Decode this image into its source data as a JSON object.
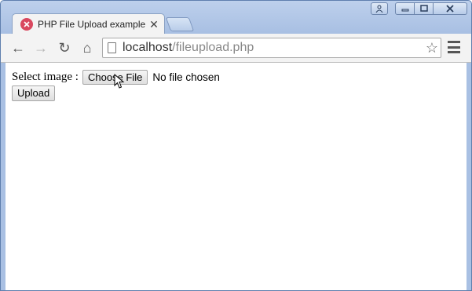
{
  "window": {
    "controls": {
      "user_icon": "person-icon",
      "minimize_icon": "minimize-icon",
      "maximize_icon": "maximize-icon",
      "close_icon": "close-icon"
    }
  },
  "tab": {
    "title": "PHP File Upload example",
    "close_glyph": "✕",
    "favicon": "xampp-icon"
  },
  "toolbar": {
    "back_glyph": "←",
    "forward_glyph": "→",
    "reload_glyph": "↻",
    "home_glyph": "⌂",
    "url_host": "localhost",
    "url_path": "/fileupload.php",
    "star_glyph": "☆"
  },
  "form": {
    "label": "Select image :",
    "choose_button": "Choose File",
    "file_status": "No file chosen",
    "upload_button": "Upload"
  }
}
